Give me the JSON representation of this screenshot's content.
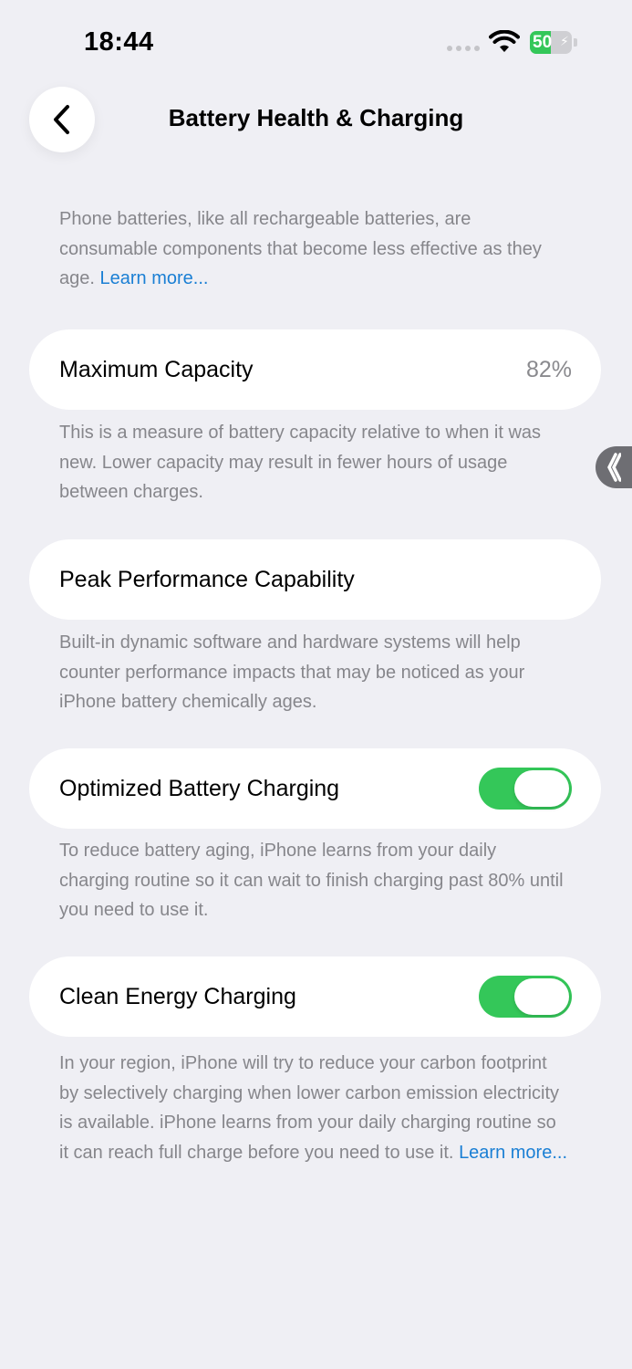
{
  "status_bar": {
    "time": "18:44",
    "battery_level": "50",
    "battery_percent": 50,
    "icons": [
      "cellular-signal-icon",
      "wifi-icon",
      "battery-charging-icon"
    ]
  },
  "nav": {
    "title": "Battery Health & Charging",
    "back_icon": "chevron-left-icon"
  },
  "intro": {
    "text": "Phone batteries, like all rechargeable batteries, are consumable components that become less effective as they age.",
    "link": "Learn more..."
  },
  "max_capacity": {
    "label": "Maximum Capacity",
    "value": "82%",
    "description": "This is a measure of battery capacity relative to when it was new. Lower capacity may result in fewer hours of usage between charges."
  },
  "peak_performance": {
    "label": "Peak Performance Capability",
    "description": "Built-in dynamic software and hardware systems will help counter performance impacts that may be noticed as your iPhone battery chemically ages."
  },
  "optimized_charging": {
    "label": "Optimized Battery Charging",
    "enabled": true,
    "description": "To reduce battery aging, iPhone learns from your daily charging routine so it can wait to finish charging past 80% until you need to use it."
  },
  "clean_energy": {
    "label": "Clean Energy Charging",
    "enabled": true,
    "description": "In your region, iPhone will try to reduce your carbon footprint by selectively charging when lower carbon emission electricity is available. iPhone learns from your daily charging routine so it can reach full charge before you need to use it.",
    "link": "Learn more..."
  },
  "colors": {
    "background": "#efeff4",
    "toggle_on": "#34c759",
    "link": "#1a7fd4",
    "secondary_text": "#86868b"
  }
}
